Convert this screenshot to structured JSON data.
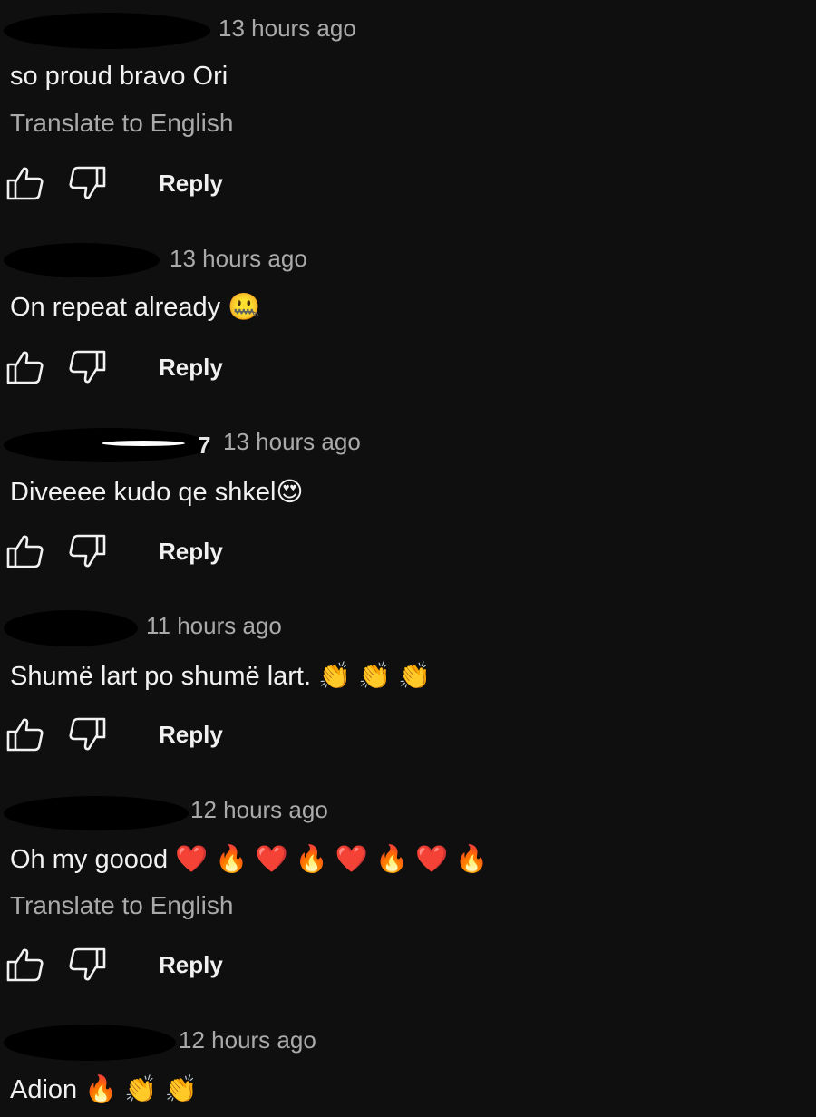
{
  "comments": [
    {
      "author_visible": "",
      "timestamp": "13 hours ago",
      "text": "so proud bravo Ori",
      "translate_label": "Translate to English",
      "reply_label": "Reply"
    },
    {
      "author_visible": "",
      "timestamp": "13 hours ago",
      "text": "On repeat already 🤐",
      "reply_label": "Reply"
    },
    {
      "author_visible": "7",
      "timestamp": "13 hours ago",
      "text": "Diveeee kudo qe shkel😍",
      "reply_label": "Reply"
    },
    {
      "author_visible": "",
      "timestamp": "11 hours ago",
      "text": "Shumë lart po shumë lart. 👏 👏 👏",
      "reply_label": "Reply"
    },
    {
      "author_visible": "",
      "timestamp": "12 hours ago",
      "text": "Oh my goood ❤️ 🔥 ❤️ 🔥 ❤️ 🔥 ❤️ 🔥",
      "translate_label": "Translate to English",
      "reply_label": "Reply"
    },
    {
      "author_visible": "",
      "timestamp": "12 hours ago",
      "text": "Adion 🔥 👏 👏"
    }
  ],
  "icons": {
    "like": "thumbs-up-icon",
    "dislike": "thumbs-down-icon"
  },
  "colors": {
    "background": "#0f0f0f",
    "text": "#f1f1f1",
    "secondary": "#aaaaaa"
  }
}
